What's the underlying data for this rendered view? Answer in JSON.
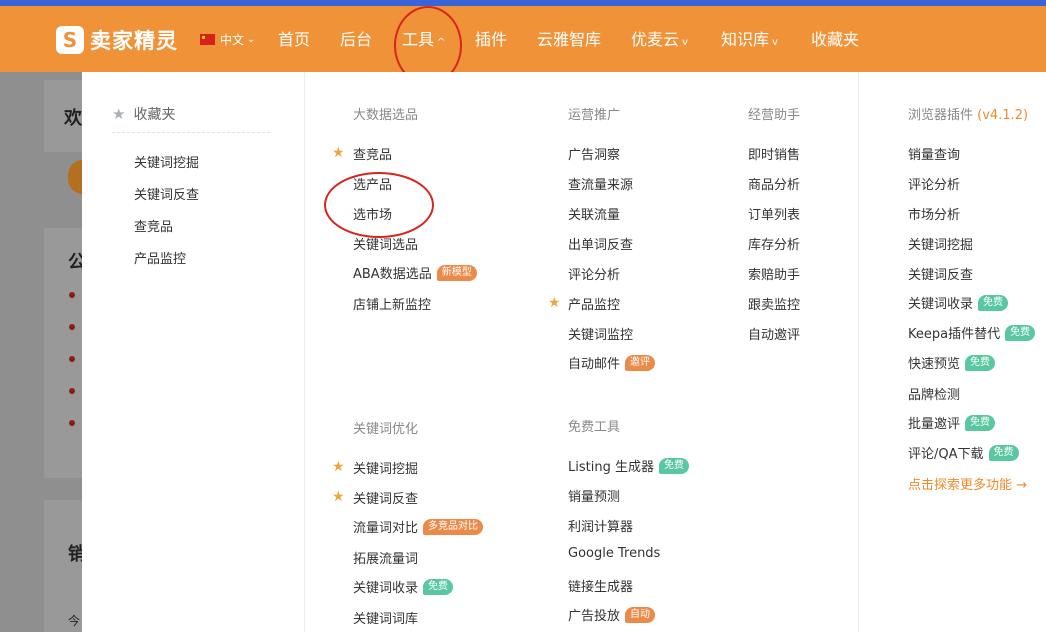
{
  "brand": {
    "name": "卖家精灵",
    "logo_glyph": "S",
    "accent": "#f09238"
  },
  "lang": {
    "label": "中文"
  },
  "nav": [
    {
      "label": "首页",
      "has_caret": false
    },
    {
      "label": "后台",
      "has_caret": false
    },
    {
      "label": "工具",
      "has_caret": true,
      "caret": "^"
    },
    {
      "label": "插件",
      "has_caret": false
    },
    {
      "label": "云雅智库",
      "has_caret": false
    },
    {
      "label": "优麦云",
      "has_caret": true,
      "caret": "v"
    },
    {
      "label": "知识库",
      "has_caret": true,
      "caret": "v"
    },
    {
      "label": "收藏夹",
      "has_caret": false
    }
  ],
  "background_page": {
    "texts": [
      "欢",
      "公",
      "销",
      "今"
    ]
  },
  "favorites": {
    "title": "收藏夹",
    "items": [
      "关键词挖掘",
      "关键词反查",
      "查竞品",
      "产品监控"
    ]
  },
  "sections": {
    "big_data": {
      "title": "大数据选品",
      "items": [
        {
          "label": "查竞品",
          "star": true
        },
        {
          "label": "选产品"
        },
        {
          "label": "选市场"
        },
        {
          "label": "关键词选品"
        },
        {
          "label": "ABA数据选品",
          "tag": "新模型",
          "tag_color": "orange"
        },
        {
          "label": "店铺上新监控"
        }
      ]
    },
    "operations": {
      "title": "运营推广",
      "items": [
        {
          "label": "广告洞察"
        },
        {
          "label": "查流量来源"
        },
        {
          "label": "关联流量"
        },
        {
          "label": "出单词反查"
        },
        {
          "label": "评论分析"
        },
        {
          "label": "产品监控",
          "star": true
        },
        {
          "label": "关键词监控"
        },
        {
          "label": "自动邮件",
          "tag": "邀评",
          "tag_color": "orange"
        }
      ]
    },
    "assistant": {
      "title": "经营助手",
      "items": [
        {
          "label": "即时销售"
        },
        {
          "label": "商品分析"
        },
        {
          "label": "订单列表"
        },
        {
          "label": "库存分析"
        },
        {
          "label": "索赔助手"
        },
        {
          "label": "跟卖监控"
        },
        {
          "label": "自动邀评"
        }
      ]
    },
    "keyword_opt": {
      "title": "关键词优化",
      "items": [
        {
          "label": "关键词挖掘",
          "star": true
        },
        {
          "label": "关键词反查",
          "star": true
        },
        {
          "label": "流量词对比",
          "tag": "多竞品对比",
          "tag_color": "orange"
        },
        {
          "label": "拓展流量词"
        },
        {
          "label": "关键词收录",
          "tag": "免费",
          "tag_color": "green"
        },
        {
          "label": "关键词词库"
        }
      ]
    },
    "free_tools": {
      "title": "免费工具",
      "items": [
        {
          "label": "Listing 生成器",
          "tag": "免费",
          "tag_color": "green"
        },
        {
          "label": "销量预测"
        },
        {
          "label": "利润计算器"
        },
        {
          "label": "Google Trends"
        },
        {
          "label": "链接生成器"
        },
        {
          "label": "广告投放",
          "tag": "自动",
          "tag_color": "orange"
        }
      ]
    },
    "extension": {
      "title": "浏览器插件",
      "version": "(v4.1.2)",
      "items": [
        {
          "label": "销量查询"
        },
        {
          "label": "评论分析"
        },
        {
          "label": "市场分析"
        },
        {
          "label": "关键词挖掘"
        },
        {
          "label": "关键词反查"
        },
        {
          "label": "关键词收录",
          "tag": "免费",
          "tag_color": "green"
        },
        {
          "label": "Keepa插件替代",
          "tag": "免费",
          "tag_color": "green"
        },
        {
          "label": "快速预览",
          "tag": "免费",
          "tag_color": "green"
        },
        {
          "label": "品牌检测"
        },
        {
          "label": "批量邀评",
          "tag": "免费",
          "tag_color": "green"
        },
        {
          "label": "评论/QA下载",
          "tag": "免费",
          "tag_color": "green"
        }
      ],
      "more": "点击探索更多功能 →"
    }
  },
  "icons": {
    "star": "star-icon",
    "flag": "china-flag-icon",
    "caret": "caret-icon"
  }
}
